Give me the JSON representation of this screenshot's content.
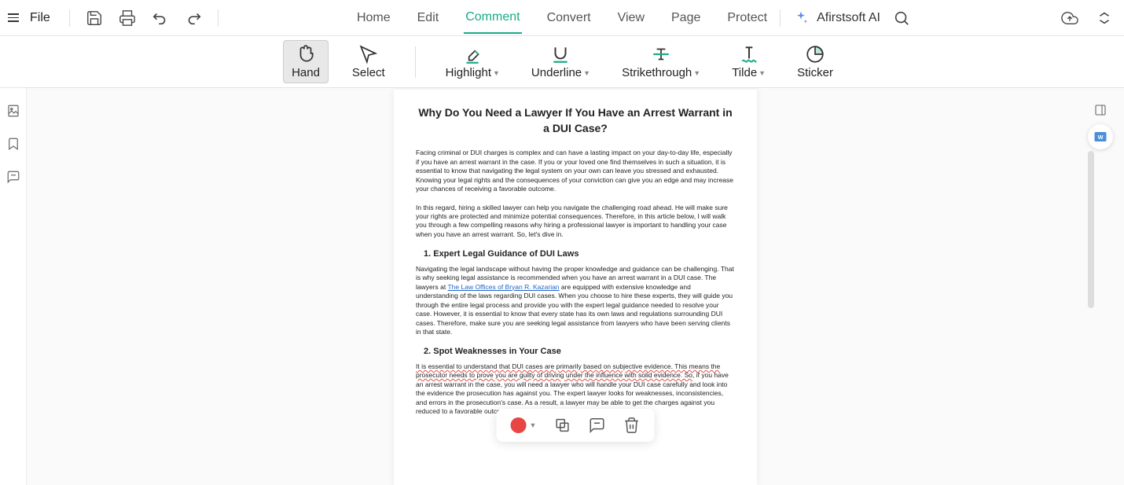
{
  "topbar": {
    "file_label": "File",
    "tabs": [
      "Home",
      "Edit",
      "Comment",
      "Convert",
      "View",
      "Page",
      "Protect"
    ],
    "active_tab": "Comment",
    "ai_label": "Afirstsoft AI"
  },
  "toolbar": {
    "hand": "Hand",
    "select": "Select",
    "highlight": "Highlight",
    "underline": "Underline",
    "strike": "Strikethrough",
    "tilde": "Tilde",
    "sticker": "Sticker"
  },
  "doc": {
    "title": "Why Do You Need a Lawyer If You Have an Arrest Warrant in a DUI Case?",
    "para1": "Facing criminal or DUI charges is complex and can have a lasting impact on your day-to-day life, especially if you have an arrest warrant in the case. If you or your loved one find themselves in such a situation, it is essential to know that navigating the legal system on your own can leave you stressed and exhausted. Knowing your legal rights and the consequences of your conviction can give you an edge and may increase your chances of receiving a favorable outcome.",
    "para2": "In this regard, hiring a skilled lawyer can help you navigate the challenging road ahead. He will make sure your rights are protected and minimize potential consequences. Therefore, in this article below, I will walk you through a few compelling reasons why hiring a professional lawyer is important to handling your case when you have an arrest warrant. So, let's dive in.",
    "h1": "1. Expert Legal Guidance of DUI Laws",
    "para3a": "Navigating the legal landscape without having the proper knowledge and guidance can be challenging. That is why seeking legal assistance is recommended when you have an arrest warrant in a DUI case. The lawyers at ",
    "link1": "The Law Offices of Bryan R. Kazarian",
    "para3b": " are equipped with extensive knowledge and understanding of the laws regarding DUI cases. When you choose to hire these experts, they will guide you through the entire legal process and provide you with the expert legal guidance needed to resolve your case. However, it is essential to know that every state has its own laws and regulations surrounding DUI cases. Therefore, make sure you are seeking legal assistance from lawyers who have been serving clients in that state.",
    "h2": "2. Spot Weaknesses in Your Case",
    "squiggle": "It is essential to understand that DUI cases are primarily based on subjective evidence. This means the prosecutor needs to prove you are guilty of driving under the influence with solid evidence. So",
    "para4b": ", if you have an arrest warrant in the case, you will need a lawyer who will handle your DUI case carefully and look into the evidence the prosecution has against you. The expert lawyer looks for weaknesses, inconsistencies, and errors in the prosecution's case. As a result, a lawyer may be able to get the charges against you reduced to a favorable outcome. This could be red"
  },
  "colors": {
    "annotation": "#e84545",
    "accent": "#1aab8a"
  }
}
